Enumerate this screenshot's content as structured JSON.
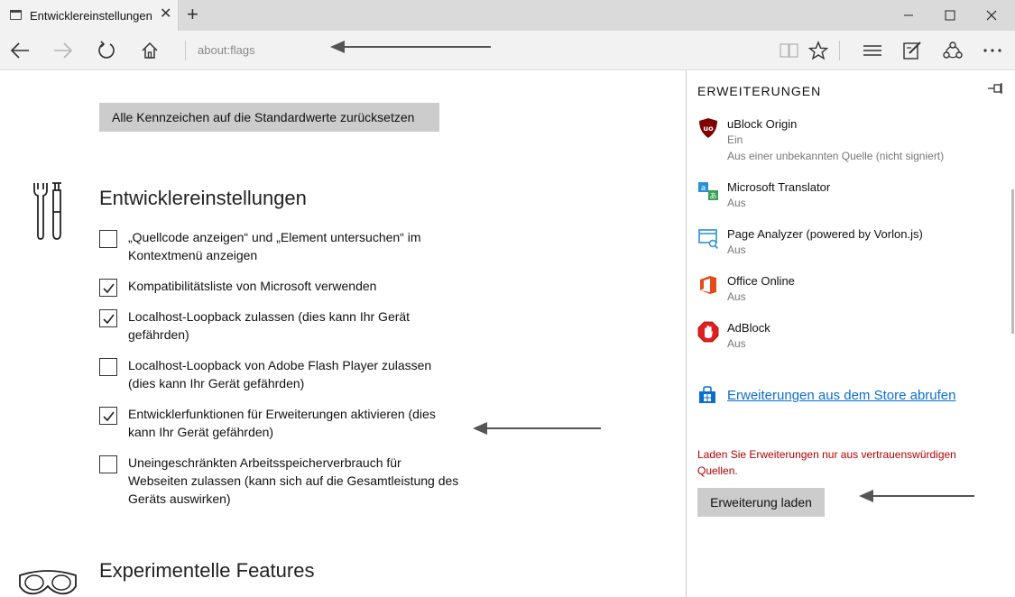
{
  "tab": {
    "title": "Entwicklereinstellungen",
    "close": "✕",
    "new_tab": "+"
  },
  "window": {
    "minimize": "minimize",
    "maximize": "maximize",
    "close": "close"
  },
  "address": {
    "url": "about:flags"
  },
  "main": {
    "reset_label": "Alle Kennzeichen auf die Standardwerte zurücksetzen",
    "dev_section_title": "Entwicklereinstellungen",
    "options": [
      {
        "label": "„Quellcode anzeigen“ und „Element untersuchen“ im Kontextmenü anzeigen",
        "checked": false
      },
      {
        "label": "Kompatibilitätsliste von Microsoft verwenden",
        "checked": true
      },
      {
        "label": "Localhost-Loopback zulassen (dies kann Ihr Gerät gefährden)",
        "checked": true
      },
      {
        "label": "Localhost-Loopback von Adobe Flash Player zulassen (dies kann Ihr Gerät gefährden)",
        "checked": false
      },
      {
        "label": "Entwicklerfunktionen für Erweiterungen aktivieren (dies kann Ihr Gerät gefährden)",
        "checked": true
      },
      {
        "label": "Uneingeschränkten Arbeitsspeicherverbrauch für Webseiten zulassen (kann sich auf die Gesamtleistung des Geräts auswirken)",
        "checked": false
      }
    ],
    "experimental_title": "Experimentelle Features"
  },
  "panel": {
    "title": "ERWEITERUNGEN",
    "extensions": [
      {
        "name": "uBlock Origin",
        "status": "Ein",
        "note": "Aus einer unbekannten Quelle (nicht signiert)",
        "icon": "ublock-icon"
      },
      {
        "name": "Microsoft Translator",
        "status": "Aus",
        "icon": "translator-icon"
      },
      {
        "name": "Page Analyzer (powered by Vorlon.js)",
        "status": "Aus",
        "icon": "page-analyzer-icon"
      },
      {
        "name": "Office Online",
        "status": "Aus",
        "icon": "office-icon"
      },
      {
        "name": "AdBlock",
        "status": "Aus",
        "icon": "adblock-icon"
      }
    ],
    "store_link": "Erweiterungen aus dem Store abrufen",
    "warning": "Laden Sie Erweiterungen nur aus vertrauenswürdigen Quellen.",
    "load_button": "Erweiterung laden"
  },
  "colors": {
    "link": "#0a6ed1",
    "warning": "#b30000",
    "button_bg": "#cccccc"
  }
}
